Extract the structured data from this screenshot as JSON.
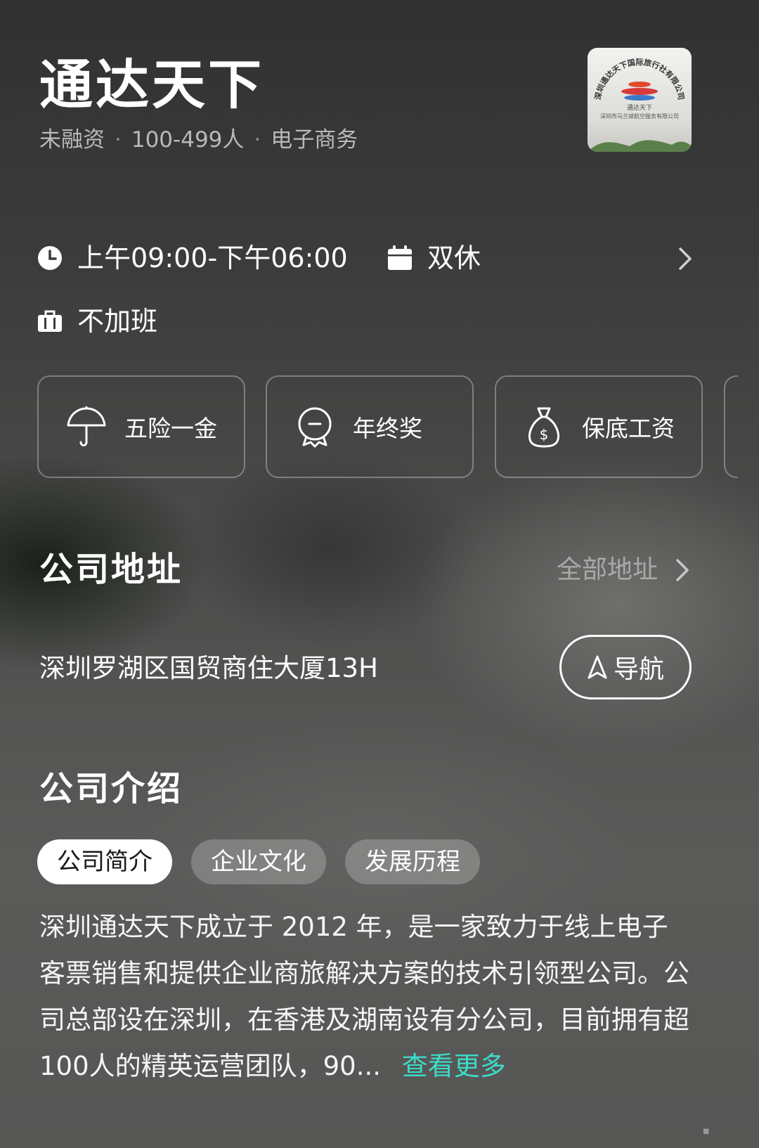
{
  "company": {
    "name": "通达天下",
    "funding": "未融资",
    "size": "100-499人",
    "industry": "电子商务",
    "logo_lines": [
      "深圳通达天下国际旅行社有限公司",
      "通达天下",
      "深圳市马兰坡航空服务有限公司"
    ]
  },
  "work_info": {
    "hours": "上午09:00-下午06:00",
    "rest": "双休",
    "overtime": "不加班"
  },
  "benefits": [
    {
      "label": "五险一金",
      "icon": "umbrella-icon"
    },
    {
      "label": "年终奖",
      "icon": "medal-icon"
    },
    {
      "label": "保底工资",
      "icon": "money-bag-icon"
    }
  ],
  "address_section": {
    "title": "公司地址",
    "all_link": "全部地址",
    "address": "深圳罗湖区国贸商住大厦13H",
    "nav_label": "导航"
  },
  "intro_section": {
    "title": "公司介绍",
    "tabs": [
      "公司简介",
      "企业文化",
      "发展历程"
    ],
    "active_tab": "公司简介",
    "text": "深圳通达天下成立于 2012 年，是一家致力于线上电子客票销售和提供企业商旅解决方案的技术引领型公司。公司总部设在深圳，在香港及湖南设有分公司，目前拥有超100人的精英运营团队，90...",
    "more": "查看更多"
  },
  "colors": {
    "accent": "#3ddbc8",
    "secondary_text": "#b9b9b9"
  }
}
